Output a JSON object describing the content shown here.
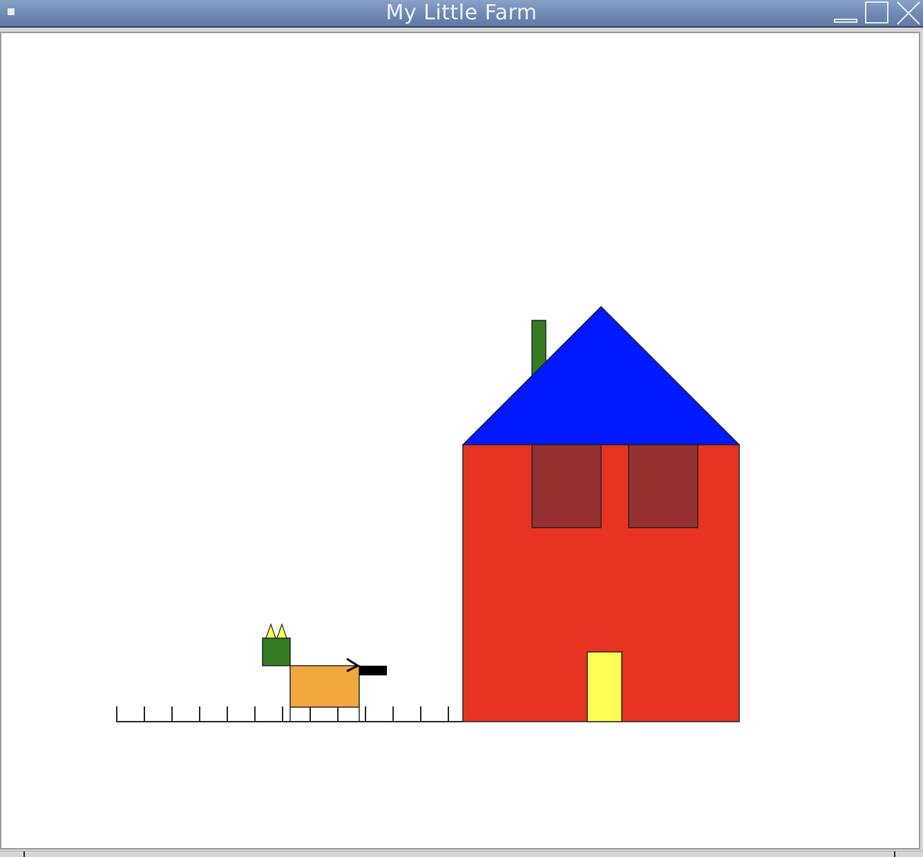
{
  "window": {
    "title": "My Little Farm"
  },
  "icons": {
    "menu": "window-menu-icon",
    "minimize": "minimize-icon",
    "maximize": "maximize-icon",
    "close": "close-icon"
  },
  "scene": {
    "roof_color": "#0019ff",
    "wall_color": "#e83222",
    "window_color": "#973030",
    "door_color": "#ffff55",
    "chimney_color": "#357b21",
    "animal_body_color": "#f0a83e",
    "animal_head_color": "#357b21",
    "animal_ear_color": "#ffff55",
    "animal_tail_color": "#000000",
    "outline_color": "#222222",
    "background_color": "#ffffff"
  }
}
